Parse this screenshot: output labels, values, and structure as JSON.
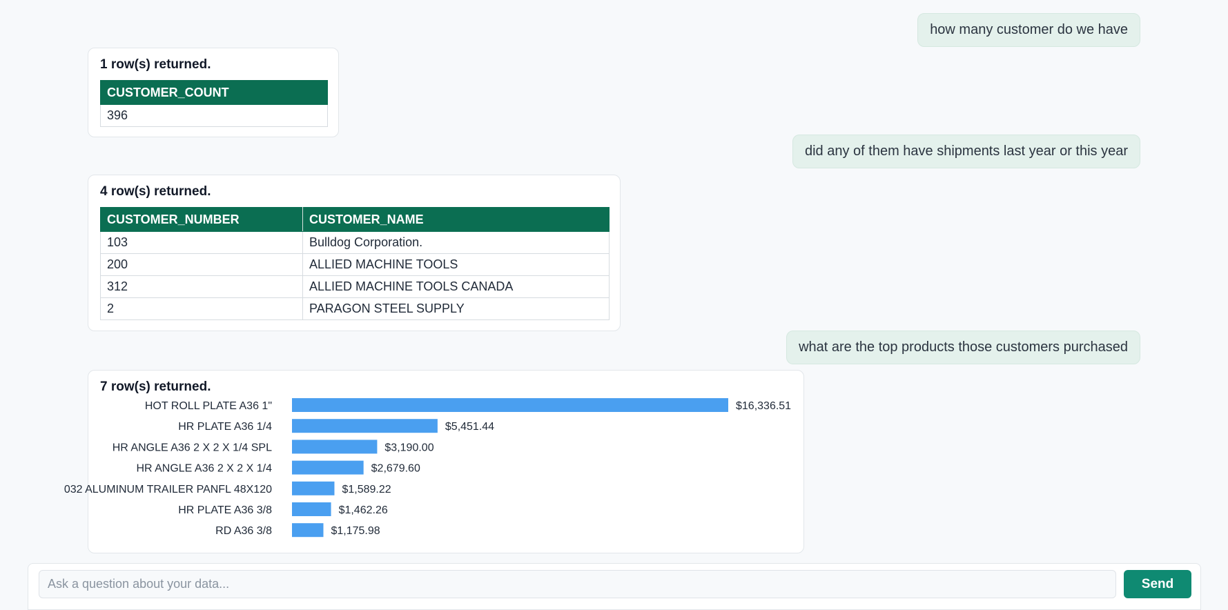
{
  "messages": {
    "q1": "how many customer do we have",
    "q2": "did any of them have shipments last year or this year",
    "q3": "what are the top products those customers purchased"
  },
  "result1": {
    "summary": "1 row(s) returned.",
    "columns": [
      "CUSTOMER_COUNT"
    ],
    "rows": [
      [
        "396"
      ]
    ]
  },
  "result2": {
    "summary": "4 row(s) returned.",
    "columns": [
      "CUSTOMER_NUMBER",
      "CUSTOMER_NAME"
    ],
    "rows": [
      [
        "103",
        "Bulldog Corporation."
      ],
      [
        "200",
        "ALLIED MACHINE TOOLS"
      ],
      [
        "312",
        "ALLIED MACHINE TOOLS CANADA"
      ],
      [
        "2",
        "PARAGON STEEL SUPPLY"
      ]
    ]
  },
  "result3": {
    "summary": "7 row(s) returned."
  },
  "chart_data": {
    "type": "bar",
    "orientation": "horizontal",
    "categories": [
      "HOT ROLL PLATE A36 1\"",
      "HR PLATE A36 1/4",
      "HR ANGLE A36 2 X 2 X 1/4 SPL",
      "HR ANGLE A36 2 X 2 X 1/4",
      "032 ALUMINUM TRAILER PANFL 48X120",
      "HR PLATE A36 3/8",
      "RD A36 3/8"
    ],
    "values": [
      16336.51,
      5451.44,
      3190.0,
      2679.6,
      1589.22,
      1462.26,
      1175.98
    ],
    "value_labels": [
      "$16,336.51",
      "$5,451.44",
      "$3,190.00",
      "$2,679.60",
      "$1,589.22",
      "$1,462.26",
      "$1,175.98"
    ],
    "bar_color": "#4a9ff0",
    "grid": false
  },
  "composer": {
    "placeholder": "Ask a question about your data...",
    "value": "",
    "send_label": "Send"
  },
  "colors": {
    "accent": "#0f8a72",
    "table_header": "#0b6e52",
    "user_bubble": "#e4f1ec"
  }
}
